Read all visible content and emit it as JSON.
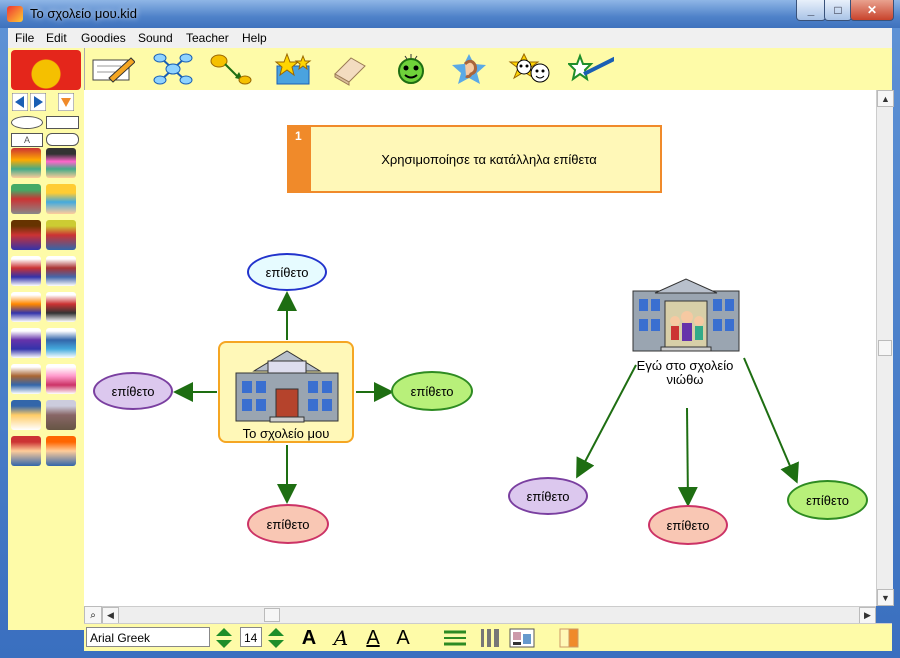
{
  "window": {
    "title": "Το σχολείο μου.kid",
    "min_label": "_",
    "max_label": "□",
    "close_label": "✕"
  },
  "menu": [
    "File",
    "Edit",
    "Goodies",
    "Sound",
    "Teacher",
    "Help"
  ],
  "toolbar": {
    "tools": [
      {
        "name": "note-tool",
        "icon": "pencil-paper-icon"
      },
      {
        "name": "diagram-view-tool",
        "icon": "diagram-nodes-icon"
      },
      {
        "name": "link-tool",
        "icon": "link-arrow-icon"
      },
      {
        "name": "symbols-tool",
        "icon": "star-box-icon"
      },
      {
        "name": "eraser-tool",
        "icon": "eraser-icon"
      },
      {
        "name": "sound-tool",
        "icon": "smiley-face-icon"
      },
      {
        "name": "listen-tool",
        "icon": "ear-icon"
      },
      {
        "name": "faces-tool",
        "icon": "faces-icon"
      },
      {
        "name": "paint-tool",
        "icon": "paintbrush-star-icon"
      }
    ]
  },
  "note": {
    "number": "1",
    "text": "Χρησιμοποίησε τα κατάλληλα επίθετα"
  },
  "left_map": {
    "center_label": "Το σχολείο μου",
    "ellipses": [
      {
        "label": "επίθετο",
        "position": "top",
        "fill": "#e6fbff",
        "stroke": "#2233cc"
      },
      {
        "label": "επίθετο",
        "position": "left",
        "fill": "#dcc8ee",
        "stroke": "#7a3fa0"
      },
      {
        "label": "επίθετο",
        "position": "right",
        "fill": "#b8f07a",
        "stroke": "#2e8b22"
      },
      {
        "label": "επίθετο",
        "position": "bottom",
        "fill": "#f9c7b4",
        "stroke": "#cc3366"
      }
    ]
  },
  "right_map": {
    "center_label": "Εγώ στο σχολείο νιώθω",
    "ellipses": [
      {
        "label": "επίθετο",
        "position": "lower-left",
        "fill": "#dcc8ee",
        "stroke": "#7a3fa0"
      },
      {
        "label": "επίθετο",
        "position": "bottom",
        "fill": "#f9c7b4",
        "stroke": "#cc3366"
      },
      {
        "label": "επίθετο",
        "position": "lower-right",
        "fill": "#b8f07a",
        "stroke": "#2e8b22"
      }
    ]
  },
  "fontbar": {
    "font_name": "Arial Greek",
    "font_size": "14",
    "bold_label": "A",
    "italic_label": "A",
    "underline_label": "A",
    "style_label": "A"
  },
  "colors": {
    "accent": "#f08a2a",
    "toolbar_bg": "#fefba8",
    "link_line": "#1e6e12"
  }
}
